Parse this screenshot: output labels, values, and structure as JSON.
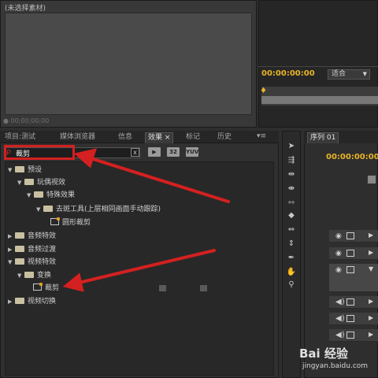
{
  "source_monitor": {
    "title": "(未选择素材)",
    "timecode": "00;00;00;00"
  },
  "program_monitor": {
    "timecode": "00:00:00:00",
    "fit_label": "适合"
  },
  "tabs": [
    {
      "label": "项目:测试"
    },
    {
      "label": "媒体浏览器"
    },
    {
      "label": "信息"
    },
    {
      "label": "效果"
    },
    {
      "label": "标记"
    },
    {
      "label": "历史"
    }
  ],
  "tab_close": "×",
  "tab_menu": "▾≡",
  "search": {
    "value": "裁剪",
    "clear_label": "x"
  },
  "badges": [
    "32",
    "YUV"
  ],
  "tree": [
    {
      "label": "预设"
    },
    {
      "label": "玩偶视效"
    },
    {
      "label": "特殊效果"
    },
    {
      "label": "去斑工具(上层相同画面手动跟踪)"
    },
    {
      "label": "圆形裁剪"
    },
    {
      "label": "音频特效"
    },
    {
      "label": "音频过渡"
    },
    {
      "label": "视频特效"
    },
    {
      "label": "变换"
    },
    {
      "label": "裁剪"
    },
    {
      "label": "视频切换"
    }
  ],
  "timeline": {
    "tab_label": "序列 01",
    "timecode": "00:00:00:00"
  },
  "watermark": {
    "logo": "Bai 经验",
    "url": "jingyan.baidu.com"
  },
  "colors": {
    "timecode": "#e8b428",
    "annotation": "#d42020"
  }
}
